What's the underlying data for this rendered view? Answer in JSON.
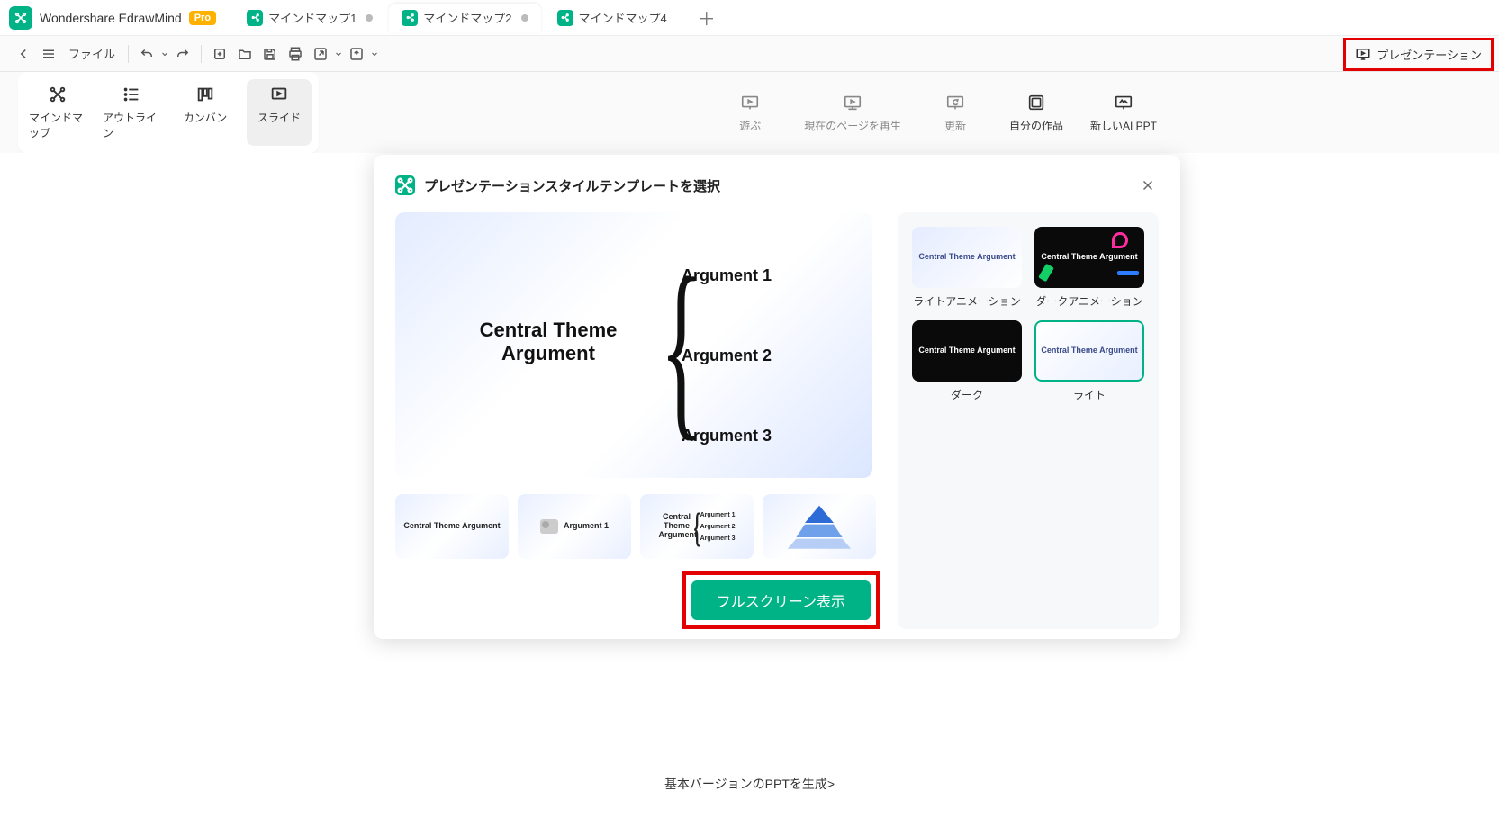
{
  "app": {
    "name": "Wondershare EdrawMind",
    "pro": "Pro"
  },
  "tabs": [
    {
      "label": "マインドマップ1",
      "active": false,
      "dirty": true
    },
    {
      "label": "マインドマップ2",
      "active": true,
      "dirty": true
    },
    {
      "label": "マインドマップ4",
      "active": false,
      "dirty": false
    }
  ],
  "toolbar": {
    "file": "ファイル",
    "presentation": "プレゼンテーション"
  },
  "views": {
    "mindmap": "マインドマップ",
    "outline": "アウトライン",
    "kanban": "カンバン",
    "slide": "スライド"
  },
  "actions": {
    "play": "遊ぶ",
    "replay": "現在のページを再生",
    "refresh": "更新",
    "myworks": "自分の作品",
    "newai": "新しいAI PPT"
  },
  "modal": {
    "title": "プレゼンテーションスタイルテンプレートを選択",
    "preview": {
      "central": "Central Theme Argument",
      "arg1": "Argument 1",
      "arg2": "Argument 2",
      "arg3": "Argument 3"
    },
    "thumbs": {
      "t1": "Central Theme Argument",
      "t2": "Argument 1",
      "t3_center": "Central Theme Argument",
      "t3_a1": "Argument 1",
      "t3_a2": "Argument 2",
      "t3_a3": "Argument 3"
    },
    "styles": {
      "light_anim": "ライトアニメーション",
      "dark_anim": "ダークアニメーション",
      "dark": "ダーク",
      "light": "ライト",
      "swatch_text": "Central Theme Argument"
    },
    "fullscreen": "フルスクリーン表示"
  },
  "footer": {
    "basic_ppt": "基本バージョンのPPTを生成>"
  }
}
